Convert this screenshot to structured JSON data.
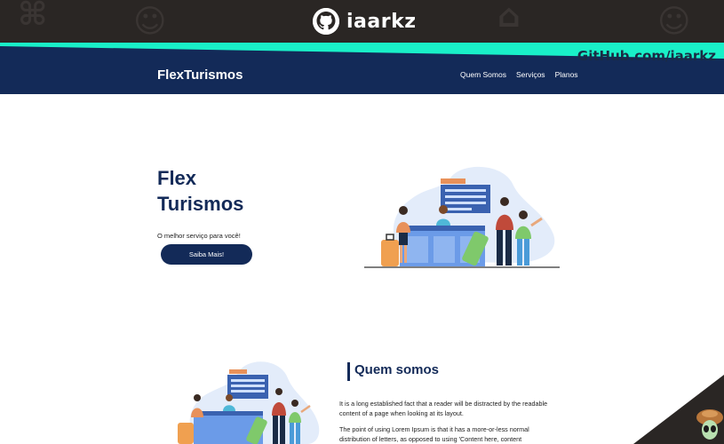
{
  "banner": {
    "brand_name": "iaarkz",
    "github_link": "GitHub.com/iaarkz",
    "bg_color": "#2a2624",
    "band_color": "#19f0c8"
  },
  "navbar": {
    "logo": "FlexTurismos",
    "links": [
      "Quem Somos",
      "Serviços",
      "Planos"
    ],
    "bg_color": "#132a58"
  },
  "hero": {
    "title_line1": "Flex",
    "title_line2": "Turismos",
    "subtitle": "O melhor serviço para você!",
    "button_label": "Saiba Mais!"
  },
  "about": {
    "title": "Quem somos",
    "paragraph1": "It is a long established fact that a reader will be distracted by the readable content of a page when looking at its layout.",
    "paragraph2": "The point of using Lorem Ipsum is that it has a more-or-less normal distribution of letters, as opposed to using 'Content here, content"
  },
  "icons": {
    "brand": "github-icon",
    "corner": "alien-mascot-icon"
  }
}
